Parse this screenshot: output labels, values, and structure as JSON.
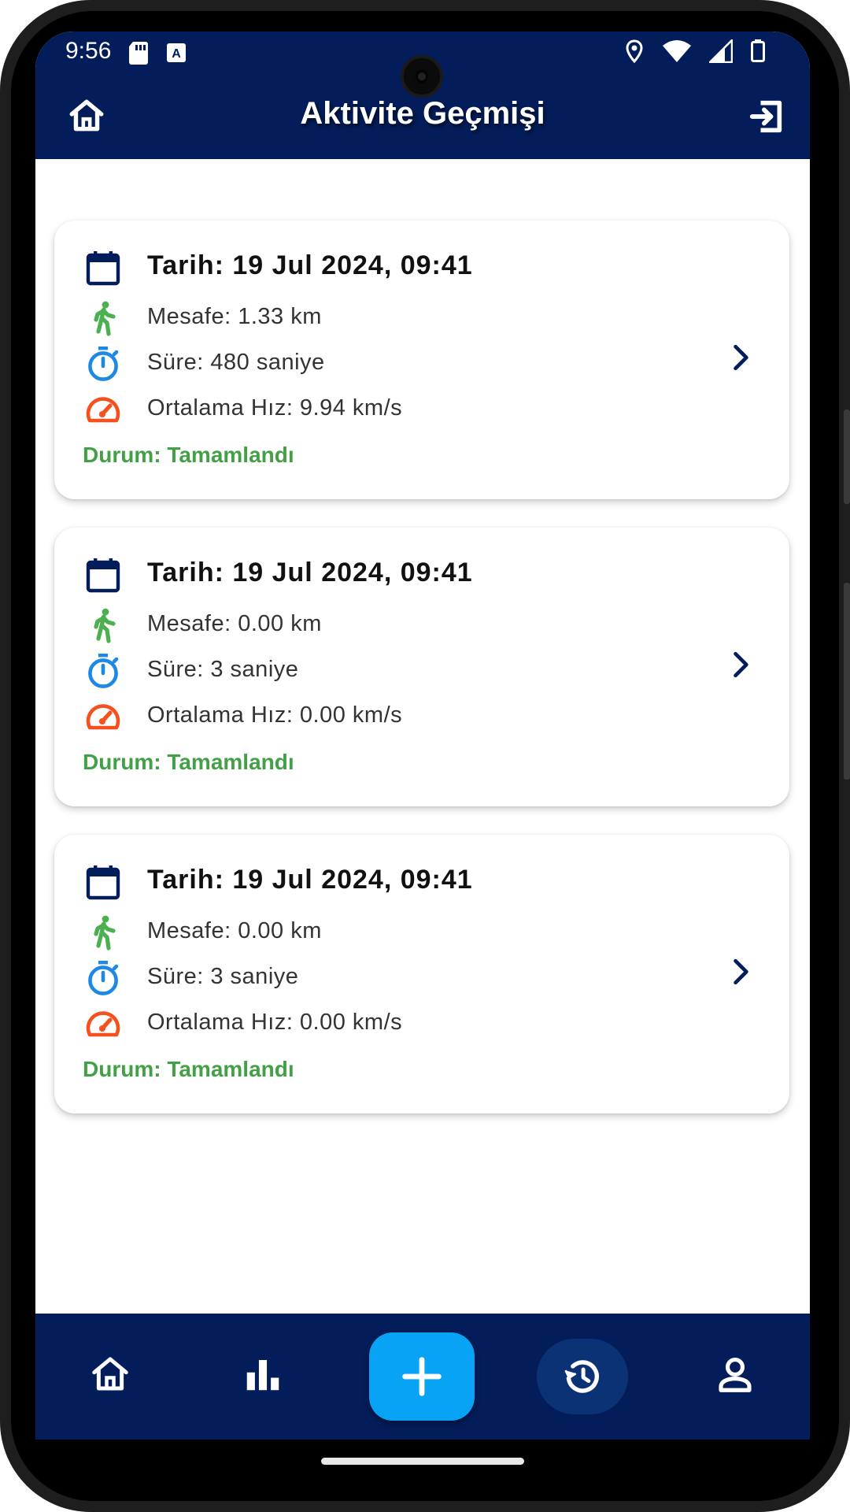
{
  "status_bar": {
    "time": "9:56"
  },
  "app_bar": {
    "title": "Aktivite Geçmişi"
  },
  "activities": [
    {
      "date": "Tarih: 19 Jul 2024, 09:41",
      "distance": "Mesafe: 1.33 km",
      "duration": "Süre: 480 saniye",
      "avg_speed": "Ortalama Hız: 9.94 km/s",
      "status": "Durum: Tamamlandı"
    },
    {
      "date": "Tarih: 19 Jul 2024, 09:41",
      "distance": "Mesafe: 0.00 km",
      "duration": "Süre: 3 saniye",
      "avg_speed": "Ortalama Hız: 0.00 km/s",
      "status": "Durum: Tamamlandı"
    },
    {
      "date": "Tarih: 19 Jul 2024, 09:41",
      "distance": "Mesafe: 0.00 km",
      "duration": "Süre: 3 saniye",
      "avg_speed": "Ortalama Hız: 0.00 km/s",
      "status": "Durum: Tamamlandı"
    }
  ],
  "icons": {
    "date": "calendar-icon",
    "distance": "walking-icon",
    "duration": "timer-icon",
    "speed": "speedometer-icon",
    "open": "chevron-right-icon"
  },
  "bottom_nav": {
    "items": [
      "home-icon",
      "bar-chart-icon",
      "add-icon",
      "history-icon",
      "person-icon"
    ],
    "active": "history-icon"
  },
  "colors": {
    "primary": "#031d5a",
    "accent": "#08a3f5",
    "status_green": "#43a047",
    "walk_green": "#4caf50",
    "timer_blue": "#1e88e5",
    "speed_orange": "#f4511e"
  }
}
